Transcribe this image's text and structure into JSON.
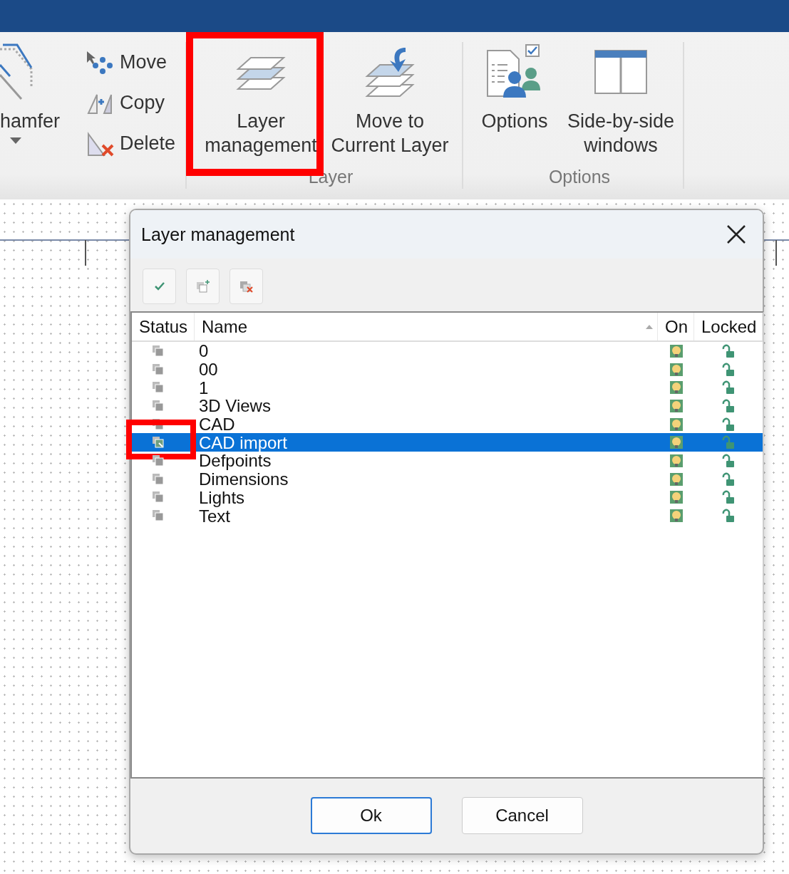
{
  "ribbon": {
    "groups": [
      {
        "buttons": [
          {
            "kind": "large",
            "label": "hamfer",
            "dropdown": true,
            "highlighted": false
          },
          {
            "kind": "small",
            "label": "Move"
          },
          {
            "kind": "small",
            "label": "Copy"
          },
          {
            "kind": "small",
            "label": "Delete"
          }
        ]
      },
      {
        "label": "Layer",
        "buttons": [
          {
            "kind": "large",
            "label": "Layer\nmanagement",
            "dropdown": false,
            "highlighted": true
          },
          {
            "kind": "large",
            "label": "Move to\nCurrent Layer",
            "dropdown": false,
            "highlighted": false
          }
        ]
      },
      {
        "label": "Options",
        "buttons": [
          {
            "kind": "large",
            "label": "Options",
            "dropdown": false,
            "highlighted": false
          },
          {
            "kind": "large",
            "label": "Side-by-side\nwindows",
            "dropdown": false,
            "highlighted": false
          }
        ]
      }
    ]
  },
  "dialog": {
    "title": "Layer management",
    "columns": [
      {
        "label": "Status",
        "sorted": false
      },
      {
        "label": "Name",
        "sorted": true
      },
      {
        "label": "On",
        "sorted": false
      },
      {
        "label": "Locked",
        "sorted": false
      }
    ],
    "rows": [
      {
        "name": "0",
        "current": false,
        "on": true,
        "locked": false,
        "selected": false,
        "highlighted": false
      },
      {
        "name": "00",
        "current": false,
        "on": true,
        "locked": false,
        "selected": false,
        "highlighted": false
      },
      {
        "name": "1",
        "current": false,
        "on": true,
        "locked": false,
        "selected": false,
        "highlighted": false
      },
      {
        "name": "3D Views",
        "current": false,
        "on": true,
        "locked": false,
        "selected": false,
        "highlighted": false
      },
      {
        "name": "CAD",
        "current": false,
        "on": true,
        "locked": false,
        "selected": false,
        "highlighted": false
      },
      {
        "name": "CAD import",
        "current": true,
        "on": true,
        "locked": false,
        "selected": true,
        "highlighted": true
      },
      {
        "name": "Defpoints",
        "current": false,
        "on": true,
        "locked": false,
        "selected": false,
        "highlighted": false
      },
      {
        "name": "Dimensions",
        "current": false,
        "on": true,
        "locked": false,
        "selected": false,
        "highlighted": false
      },
      {
        "name": "Lights",
        "current": false,
        "on": true,
        "locked": false,
        "selected": false,
        "highlighted": false
      },
      {
        "name": "Text",
        "current": false,
        "on": true,
        "locked": false,
        "selected": false,
        "highlighted": false
      }
    ],
    "buttons": [
      {
        "label": "Ok",
        "default": true
      },
      {
        "label": "Cancel",
        "default": false
      }
    ]
  }
}
